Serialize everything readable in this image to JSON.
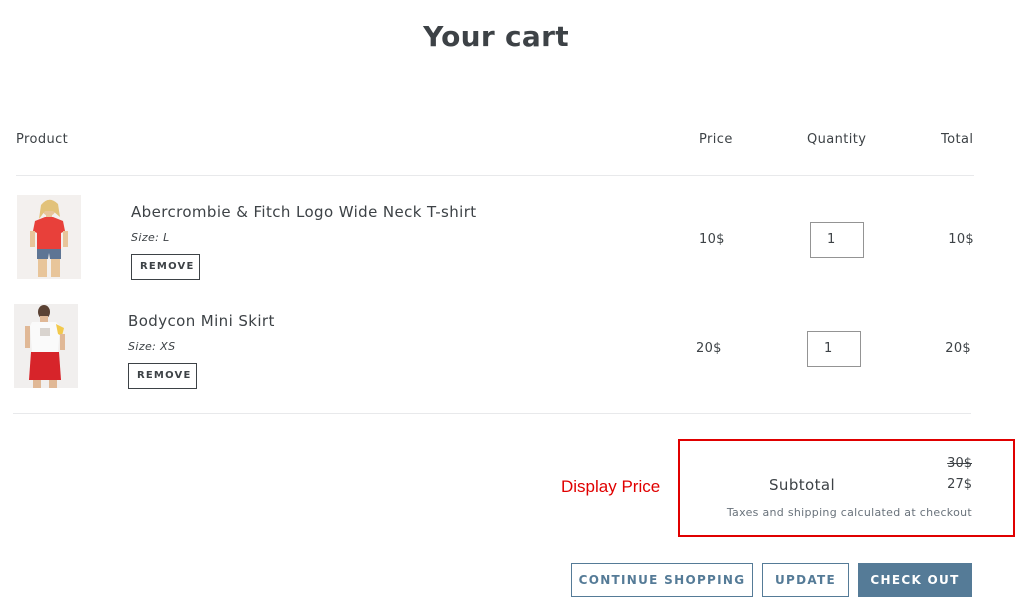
{
  "page": {
    "title": "Your cart"
  },
  "table": {
    "headers": {
      "product": "Product",
      "price": "Price",
      "quantity": "Quantity",
      "total": "Total"
    },
    "items": [
      {
        "title": "Abercrombie & Fitch Logo Wide Neck T-shirt",
        "option": "Size: L",
        "remove_label": "REMOVE",
        "price": "10$",
        "quantity": "1",
        "total": "10$",
        "image_icon": "product-photo-tshirt"
      },
      {
        "title": "Bodycon Mini Skirt",
        "option": "Size: XS",
        "remove_label": "REMOVE",
        "price": "20$",
        "quantity": "1",
        "total": "20$",
        "image_icon": "product-photo-skirt"
      }
    ]
  },
  "summary": {
    "original_price": "30$",
    "subtotal_label": "Subtotal",
    "subtotal_value": "27$",
    "tax_note": "Taxes and shipping calculated at checkout",
    "annotation_label": "Display Price"
  },
  "actions": {
    "continue_label": "CONTINUE SHOPPING",
    "update_label": "UPDATE",
    "checkout_label": "CHECK OUT"
  },
  "colors": {
    "text": "#3d4246",
    "accent": "#557b97",
    "annotation": "#e00000",
    "divider": "#e8e9eb"
  }
}
